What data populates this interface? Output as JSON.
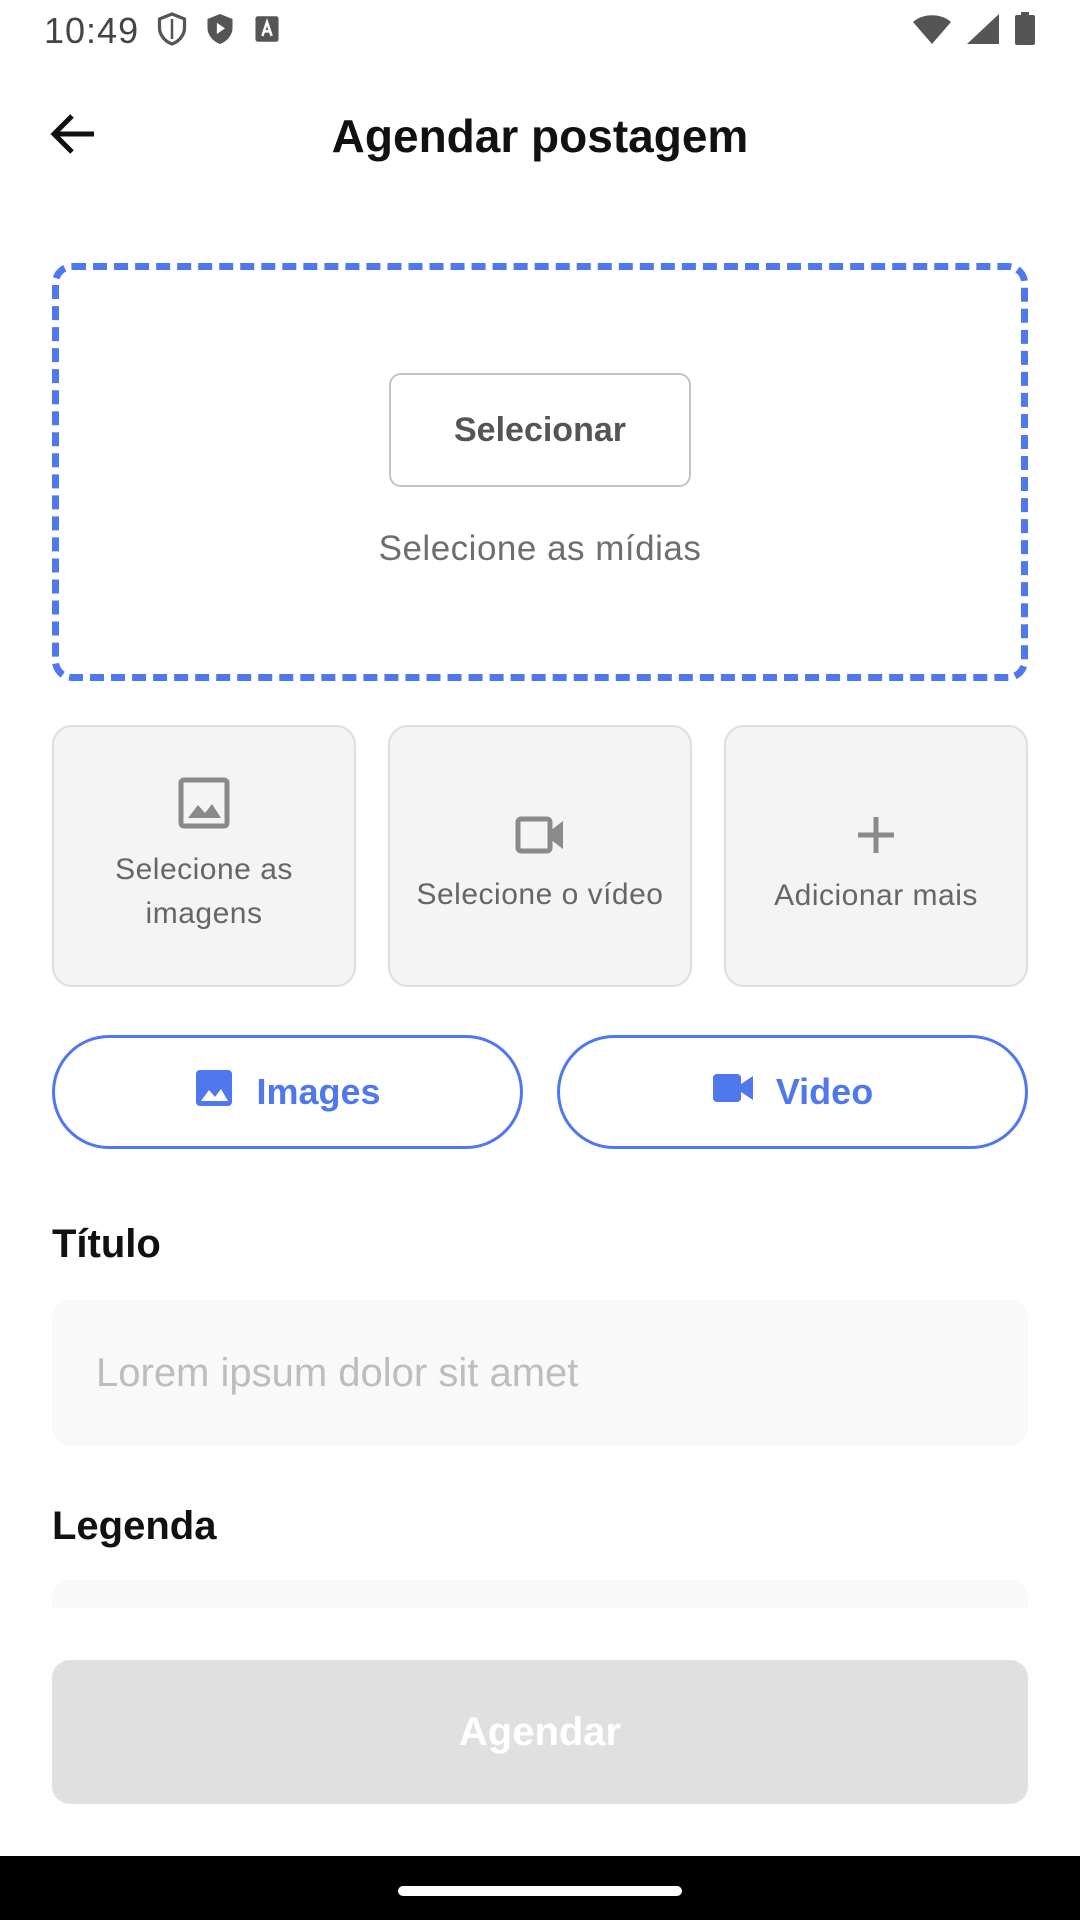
{
  "status_bar": {
    "time": "10:49"
  },
  "header": {
    "title": "Agendar postagem"
  },
  "dropzone": {
    "select_button_label": "Selecionar",
    "hint": "Selecione as mídias"
  },
  "tiles": [
    {
      "label": "Selecione as imagens",
      "icon": "image-outline-icon"
    },
    {
      "label": "Selecione o vídeo",
      "icon": "videocam-outline-icon"
    },
    {
      "label": "Adicionar mais",
      "icon": "plus-icon"
    }
  ],
  "media_buttons": {
    "images_label": "Images",
    "video_label": "Video"
  },
  "form": {
    "title_label": "Título",
    "title_placeholder": "Lorem ipsum dolor sit amet",
    "caption_label": "Legenda"
  },
  "submit": {
    "label": "Agendar"
  },
  "colors": {
    "accent": "#4f78ef",
    "disabled_button": "#e0e0e0",
    "tile_background": "#f4f4f4",
    "field_background": "#f9f9f9"
  }
}
